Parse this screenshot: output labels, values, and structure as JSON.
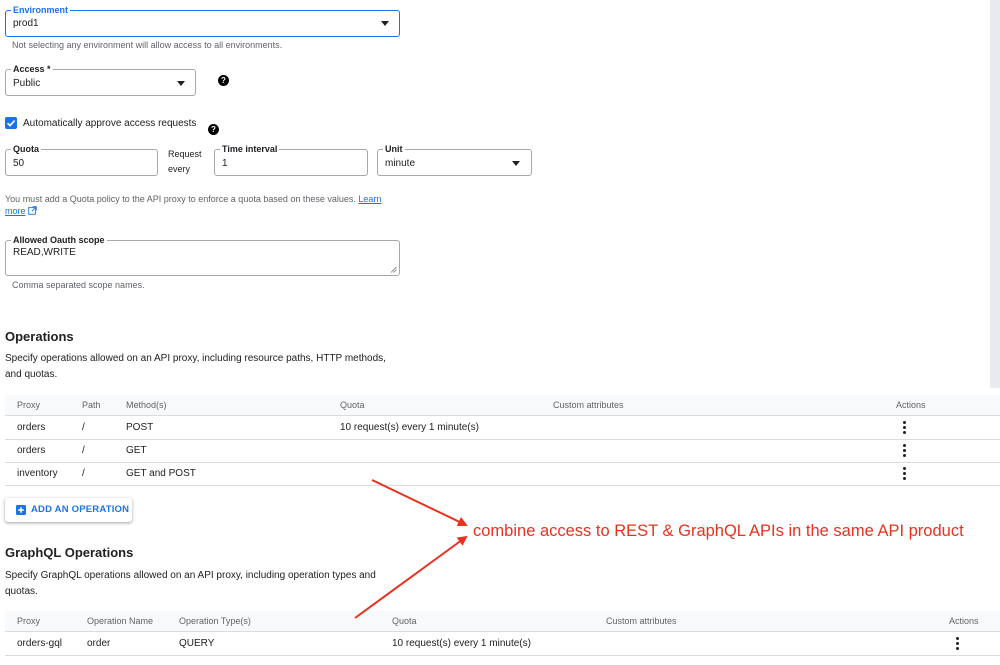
{
  "environment": {
    "label": "Environment",
    "value": "prod1",
    "helper": "Not selecting any environment will allow access to all environments."
  },
  "access": {
    "label": "Access *",
    "value": "Public"
  },
  "auto_approve": {
    "label": "Automatically approve access requests",
    "checked": true
  },
  "quota": {
    "quota_label": "Quota",
    "quota_value": "50",
    "request_every_line1": "Request",
    "request_every_line2": "every",
    "interval_label": "Time interval",
    "interval_value": "1",
    "unit_label": "Unit",
    "unit_value": "minute",
    "note_text": "You must add a Quota policy to the API proxy to enforce a quota based on these values.",
    "learn_more_1": "Learn",
    "learn_more_2": "more"
  },
  "oauth": {
    "label": "Allowed Oauth scope",
    "value": "READ,WRITE",
    "helper": "Comma separated scope names."
  },
  "operations": {
    "title": "Operations",
    "desc_line1": "Specify operations allowed on an API proxy, including resource paths, HTTP methods,",
    "desc_line2": "and quotas.",
    "headers": {
      "proxy": "Proxy",
      "path": "Path",
      "methods": "Method(s)",
      "quota": "Quota",
      "custom": "Custom attributes",
      "actions": "Actions"
    },
    "rows": [
      {
        "proxy": "orders",
        "path": "/",
        "methods": "POST",
        "quota": "10 request(s) every 1 minute(s)"
      },
      {
        "proxy": "orders",
        "path": "/",
        "methods": "GET",
        "quota": ""
      },
      {
        "proxy": "inventory",
        "path": "/",
        "methods": "GET and POST",
        "quota": ""
      }
    ],
    "add_button": "ADD AN OPERATION"
  },
  "graphql": {
    "title": "GraphQL Operations",
    "desc_line1": "Specify GraphQL operations allowed on an API proxy, including operation types and",
    "desc_line2": "quotas.",
    "headers": {
      "proxy": "Proxy",
      "op_name": "Operation Name",
      "op_type": "Operation Type(s)",
      "quota": "Quota",
      "custom": "Custom attributes",
      "actions": "Actions"
    },
    "rows": [
      {
        "proxy": "orders-gql",
        "op_name": "order",
        "op_type": "QUERY",
        "quota": "10 request(s) every 1 minute(s)"
      }
    ]
  },
  "annotation": {
    "text": "combine access to REST & GraphQL APIs in the same API product",
    "color": "#e8321e"
  },
  "colors": {
    "accent": "#1a73e8",
    "focus_border": "#1a73e8"
  },
  "icons": {
    "dropdown": "caret-down-icon",
    "help": "help-circle-icon",
    "external": "external-link-icon",
    "add": "add-box-icon",
    "more": "more-vert-icon"
  }
}
